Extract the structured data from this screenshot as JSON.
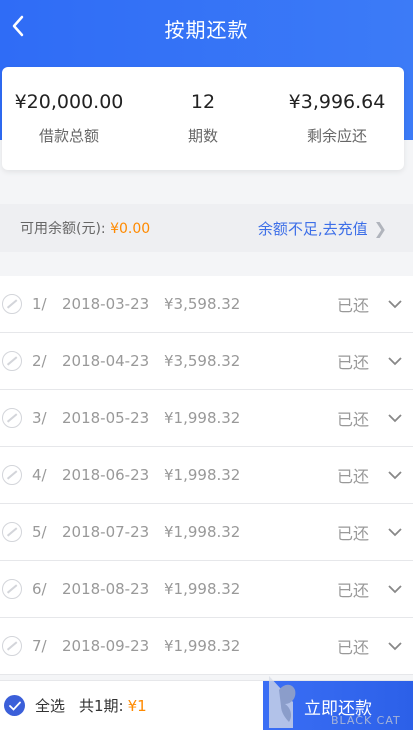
{
  "header": {
    "title": "按期还款"
  },
  "summary": [
    {
      "value": "¥20,000.00",
      "label": "借款总额"
    },
    {
      "value": "12",
      "label": "期数"
    },
    {
      "value": "¥3,996.64",
      "label": "剩余应还"
    }
  ],
  "balance": {
    "label": "可用余额(元):",
    "amount": "¥0.00",
    "action": "余额不足,去充值"
  },
  "installments": [
    {
      "index": "1/",
      "date": "2018-03-23",
      "amount": "¥3,598.32",
      "status": "已还"
    },
    {
      "index": "2/",
      "date": "2018-04-23",
      "amount": "¥3,598.32",
      "status": "已还"
    },
    {
      "index": "3/",
      "date": "2018-05-23",
      "amount": "¥1,998.32",
      "status": "已还"
    },
    {
      "index": "4/",
      "date": "2018-06-23",
      "amount": "¥1,998.32",
      "status": "已还"
    },
    {
      "index": "5/",
      "date": "2018-07-23",
      "amount": "¥1,998.32",
      "status": "已还"
    },
    {
      "index": "6/",
      "date": "2018-08-23",
      "amount": "¥1,998.32",
      "status": "已还"
    },
    {
      "index": "7/",
      "date": "2018-09-23",
      "amount": "¥1,998.32",
      "status": "已还"
    }
  ],
  "footer": {
    "select_all": "全选",
    "total_label": "共1期:",
    "total_amount": "¥1",
    "pay_button": "立即还款"
  },
  "watermark": {
    "text": "BLACK CAT"
  },
  "colors": {
    "primary": "#2f6cf6",
    "accent": "#ff8a00",
    "link": "#3d6fe8"
  }
}
